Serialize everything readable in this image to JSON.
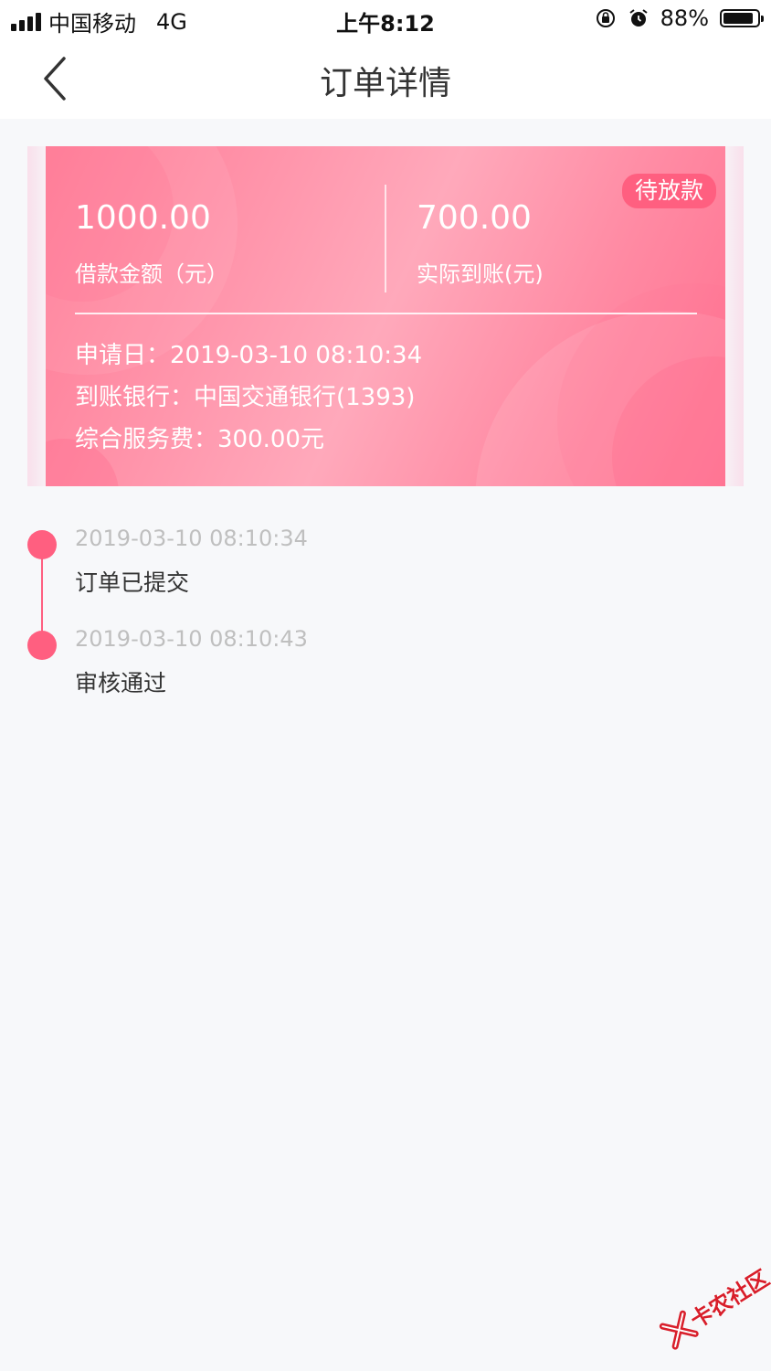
{
  "status_bar": {
    "carrier": "中国移动",
    "network": "4G",
    "time": "上午8:12",
    "battery": "88%",
    "battery_level": 0.88
  },
  "nav": {
    "title": "订单详情"
  },
  "card": {
    "badge": "待放款",
    "loan_amount": "1000.00",
    "loan_amount_label": "借款金额（元）",
    "received_amount": "700.00",
    "received_amount_label": "实际到账(元)",
    "apply_date": "申请日：2019-03-10 08:10:34",
    "bank": "到账银行：中国交通银行(1393)",
    "service_fee": "综合服务费：300.00元",
    "accent_color": "#ff5f80"
  },
  "timeline": [
    {
      "time": "2019-03-10 08:10:34",
      "text": "订单已提交"
    },
    {
      "time": "2019-03-10 08:10:43",
      "text": "审核通过"
    }
  ],
  "watermark": {
    "text": "卡农社区"
  }
}
